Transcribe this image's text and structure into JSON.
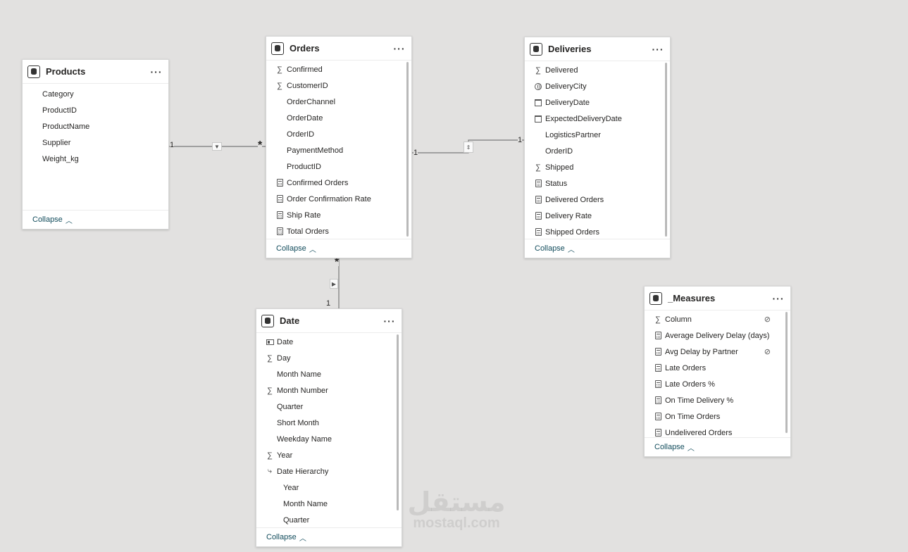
{
  "tables": {
    "products": {
      "title": "Products",
      "fields": [
        {
          "icon": "none",
          "label": "Category"
        },
        {
          "icon": "none",
          "label": "ProductID"
        },
        {
          "icon": "none",
          "label": "ProductName"
        },
        {
          "icon": "none",
          "label": "Supplier"
        },
        {
          "icon": "none",
          "label": "Weight_kg"
        }
      ]
    },
    "orders": {
      "title": "Orders",
      "fields": [
        {
          "icon": "sigma",
          "label": "Confirmed"
        },
        {
          "icon": "sigma",
          "label": "CustomerID"
        },
        {
          "icon": "none",
          "label": "OrderChannel"
        },
        {
          "icon": "none",
          "label": "OrderDate"
        },
        {
          "icon": "none",
          "label": "OrderID"
        },
        {
          "icon": "none",
          "label": "PaymentMethod"
        },
        {
          "icon": "none",
          "label": "ProductID"
        },
        {
          "icon": "calc",
          "label": "Confirmed Orders"
        },
        {
          "icon": "calc",
          "label": "Order Confirmation Rate"
        },
        {
          "icon": "calc",
          "label": "Ship Rate"
        },
        {
          "icon": "calc",
          "label": "Total Orders"
        }
      ]
    },
    "deliveries": {
      "title": "Deliveries",
      "fields": [
        {
          "icon": "sigma",
          "label": "Delivered"
        },
        {
          "icon": "globe",
          "label": "DeliveryCity"
        },
        {
          "icon": "calendar",
          "label": "DeliveryDate"
        },
        {
          "icon": "calendar",
          "label": "ExpectedDeliveryDate"
        },
        {
          "icon": "none",
          "label": "LogisticsPartner"
        },
        {
          "icon": "none",
          "label": "OrderID"
        },
        {
          "icon": "sigma",
          "label": "Shipped"
        },
        {
          "icon": "calc",
          "label": "Status"
        },
        {
          "icon": "calc",
          "label": "Delivered Orders"
        },
        {
          "icon": "calc",
          "label": "Delivery Rate"
        },
        {
          "icon": "calc",
          "label": "Shipped Orders"
        }
      ]
    },
    "date": {
      "title": "Date",
      "fields": [
        {
          "icon": "idcard",
          "label": "Date"
        },
        {
          "icon": "sigma",
          "label": "Day"
        },
        {
          "icon": "none",
          "label": "Month Name"
        },
        {
          "icon": "sigma",
          "label": "Month Number"
        },
        {
          "icon": "none",
          "label": "Quarter"
        },
        {
          "icon": "none",
          "label": "Short Month"
        },
        {
          "icon": "none",
          "label": "Weekday Name"
        },
        {
          "icon": "sigma",
          "label": "Year"
        },
        {
          "icon": "hierarchy",
          "label": "Date Hierarchy"
        },
        {
          "icon": "sub",
          "label": "Year"
        },
        {
          "icon": "sub",
          "label": "Month Name"
        },
        {
          "icon": "sub",
          "label": "Quarter"
        }
      ]
    },
    "measures": {
      "title": "_Measures",
      "fields": [
        {
          "icon": "sigma",
          "label": "Column",
          "hidden": true
        },
        {
          "icon": "calc",
          "label": "Average Delivery Delay (days)"
        },
        {
          "icon": "calc",
          "label": "Avg Delay by Partner",
          "hidden": true
        },
        {
          "icon": "calc",
          "label": "Late Orders"
        },
        {
          "icon": "calc",
          "label": "Late Orders %"
        },
        {
          "icon": "calc",
          "label": "On Time Delivery %"
        },
        {
          "icon": "calc",
          "label": "On Time Orders"
        },
        {
          "icon": "calc",
          "label": "Undelivered Orders"
        }
      ]
    }
  },
  "ui": {
    "collapse_label": "Collapse",
    "more_label": "···"
  },
  "relationships": {
    "products_orders": {
      "one": "1",
      "many": "*"
    },
    "orders_deliveries": {
      "left": "1",
      "right": "1"
    },
    "date_orders": {
      "one": "1",
      "many": "*"
    }
  },
  "watermark": {
    "arabic": "مستقل",
    "latin": "mostaql.com"
  }
}
